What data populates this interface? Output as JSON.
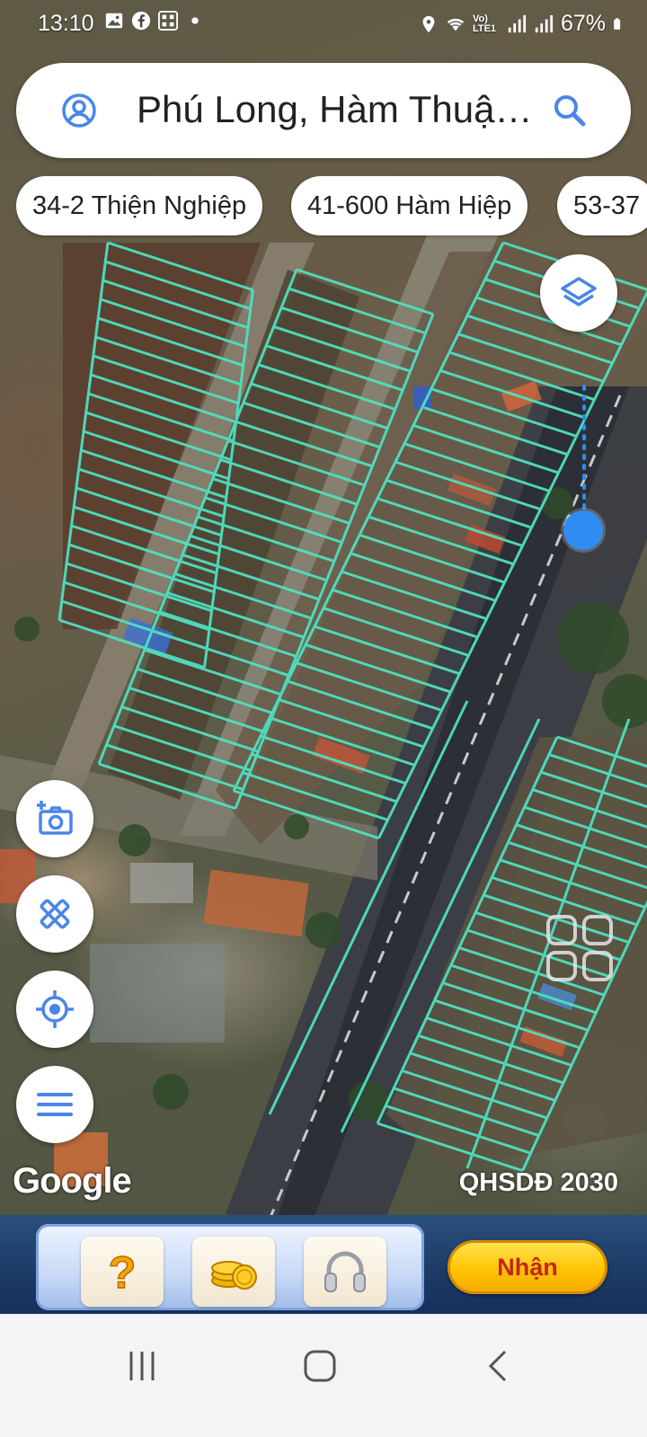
{
  "status_bar": {
    "time": "13:10",
    "battery": "67%",
    "network": "Vo) LTE1",
    "left_icons": [
      "image-icon",
      "facebook-icon",
      "qr-app-icon",
      "dot-icon"
    ],
    "right_icons": [
      "location-icon",
      "wifi-icon",
      "signal-icon",
      "signal-icon",
      "battery-icon"
    ]
  },
  "search": {
    "query": "Phú Long, Hàm Thuậ…",
    "profile_icon": "account-circle-icon",
    "search_icon": "search-icon"
  },
  "chips": [
    {
      "label": "34-2 Thiện Nghiệp"
    },
    {
      "label": "41-600 Hàm Hiệp"
    },
    {
      "label": "53-37"
    }
  ],
  "map": {
    "layers_icon": "layers-icon",
    "brand": "Google",
    "overlay_label": "QHSDĐ 2030",
    "parcel_color": "#4fe0c0",
    "location_dot_color": "#2f8cf2"
  },
  "side_tools": [
    {
      "name": "camera-add-icon"
    },
    {
      "name": "measure-tools-icon"
    },
    {
      "name": "my-location-icon"
    },
    {
      "name": "menu-icon"
    }
  ],
  "ad": {
    "tiles": [
      "question-icon",
      "coins-icon",
      "headphones-icon"
    ],
    "cta": "Nhận"
  },
  "nav": [
    "recent-apps-icon",
    "home-icon",
    "back-icon"
  ]
}
